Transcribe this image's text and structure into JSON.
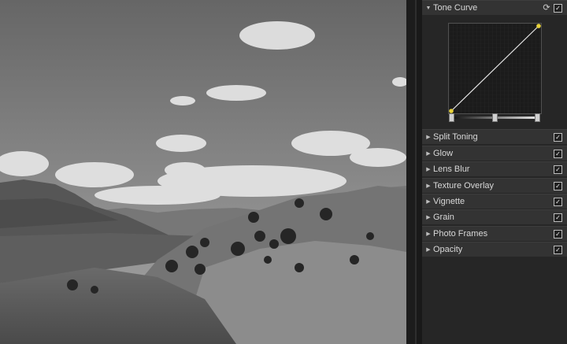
{
  "panel": {
    "tone_curve": {
      "label": "Tone Curve",
      "checked": true,
      "expanded": true,
      "curve_points": [
        [
          0,
          0
        ],
        [
          1,
          1
        ]
      ]
    },
    "sections": [
      {
        "label": "Split Toning",
        "checked": true
      },
      {
        "label": "Glow",
        "checked": true
      },
      {
        "label": "Lens Blur",
        "checked": true
      },
      {
        "label": "Texture Overlay",
        "checked": true
      },
      {
        "label": "Vignette",
        "checked": true
      },
      {
        "label": "Grain",
        "checked": true
      },
      {
        "label": "Photo Frames",
        "checked": true
      },
      {
        "label": "Opacity",
        "checked": true
      }
    ]
  },
  "glyphs": {
    "expanded": "▼",
    "collapsed": "▶",
    "check": "✓",
    "reset": "⟳"
  },
  "colors": {
    "curve_point": "#e8d23a",
    "panel_bg": "#262626",
    "header_bg": "#333333"
  }
}
